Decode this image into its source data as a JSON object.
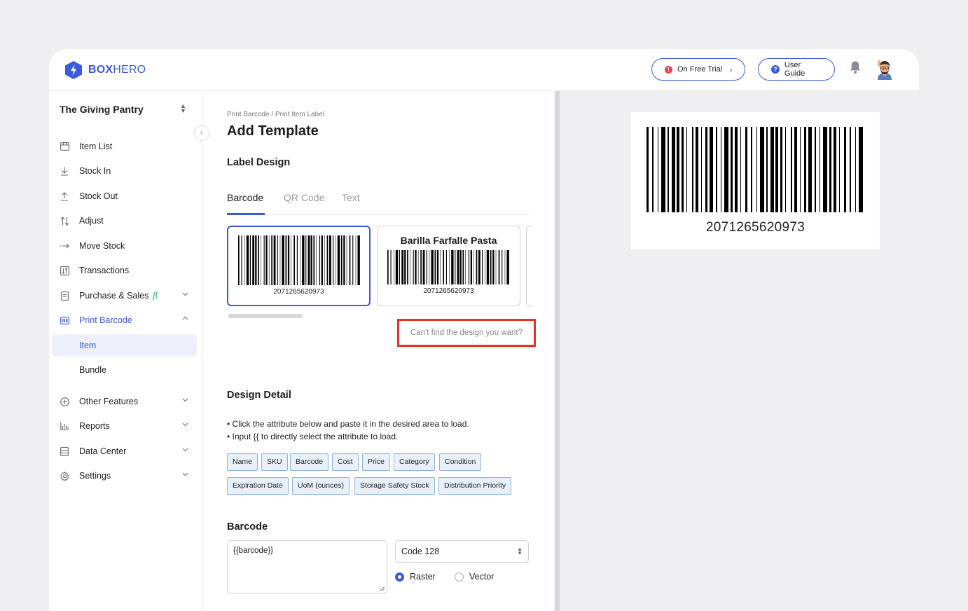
{
  "brand": {
    "bold": "BOX",
    "light": "HERO"
  },
  "header": {
    "trial_label": "On Free Trial",
    "trial_badge": "!",
    "guide_label": "User Guide",
    "guide_badge": "?"
  },
  "sidebar": {
    "org_name": "The Giving Pantry",
    "items": [
      {
        "label": "Item List",
        "icon": "box-icon"
      },
      {
        "label": "Stock In",
        "icon": "arrow-down-icon"
      },
      {
        "label": "Stock Out",
        "icon": "arrow-up-icon"
      },
      {
        "label": "Adjust",
        "icon": "adjust-arrows-icon"
      },
      {
        "label": "Move Stock",
        "icon": "move-arrow-icon"
      },
      {
        "label": "Transactions",
        "icon": "transactions-icon"
      },
      {
        "label": "Purchase & Sales",
        "icon": "document-icon",
        "beta": "β"
      },
      {
        "label": "Print Barcode",
        "icon": "barcode-icon"
      },
      {
        "label": "Other Features",
        "icon": "plus-circle-icon"
      },
      {
        "label": "Reports",
        "icon": "bar-chart-icon"
      },
      {
        "label": "Data Center",
        "icon": "database-icon"
      },
      {
        "label": "Settings",
        "icon": "gear-icon"
      }
    ],
    "sub_items": [
      "Item",
      "Bundle"
    ]
  },
  "main": {
    "breadcrumb": "Print Barcode / Print Item Label",
    "title": "Add Template",
    "label_design": "Label Design",
    "tabs": [
      "Barcode",
      "QR Code",
      "Text"
    ],
    "templates": [
      {
        "barcode_number": "2071265620973"
      },
      {
        "product_name": "Barilla Farfalle Pasta",
        "barcode_number": "2071265620973"
      }
    ],
    "cant_find": "Can't find the design you want?",
    "design_detail": "Design Detail",
    "instructions": [
      "• Click the attribute below and paste it in the desired area to load.",
      "• Input {{ to directly select the attribute to load."
    ],
    "attributes": [
      "Name",
      "SKU",
      "Barcode",
      "Cost",
      "Price",
      "Category",
      "Condition",
      "Expiration Date",
      "UoM (ounces)",
      "Storage Safety Stock",
      "Distribution Priority"
    ],
    "barcode_section": "Barcode",
    "barcode_value": "{{barcode}}",
    "barcode_type": "Code 128",
    "render_options": [
      "Raster",
      "Vector"
    ],
    "render_selected": "Raster"
  },
  "preview": {
    "barcode_number": "2071265620973"
  }
}
